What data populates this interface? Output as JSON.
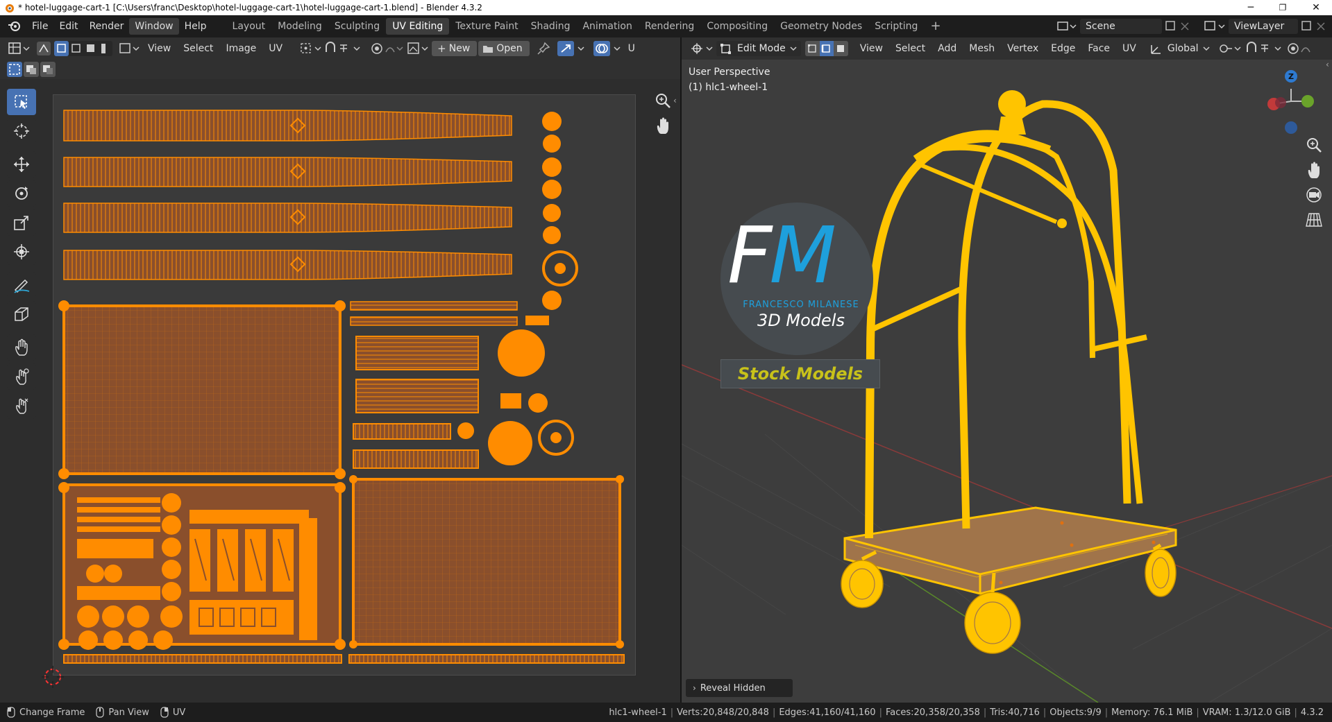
{
  "window": {
    "title": "* hotel-luggage-cart-1 [C:\\Users\\franc\\Desktop\\hotel-luggage-cart-1\\hotel-luggage-cart-1.blend] - Blender 4.3.2",
    "minimize": "─",
    "maximize": "❐",
    "close": "✕"
  },
  "menubar": {
    "items": [
      "File",
      "Edit",
      "Render",
      "Window",
      "Help"
    ],
    "active": "Window"
  },
  "workspaces": {
    "tabs": [
      "Layout",
      "Modeling",
      "Sculpting",
      "UV Editing",
      "Texture Paint",
      "Shading",
      "Animation",
      "Rendering",
      "Compositing",
      "Geometry Nodes",
      "Scripting"
    ],
    "active": "UV Editing",
    "add_label": "+"
  },
  "scene": {
    "label": "Scene"
  },
  "viewlayer": {
    "label": "ViewLayer"
  },
  "uv_editor": {
    "menus": [
      "View",
      "Select",
      "Image",
      "UV"
    ],
    "new_label": "New",
    "open_label": "Open",
    "cut_label": "U"
  },
  "viewport": {
    "mode_label": "Edit Mode",
    "menus": [
      "View",
      "Select",
      "Add",
      "Mesh",
      "Vertex",
      "Edge",
      "Face",
      "UV"
    ],
    "transform_orientation": "Global",
    "perspective_label": "User Perspective",
    "object_label": "(1) hlc1-wheel-1",
    "reveal_hidden_label": "Reveal Hidden",
    "gizmo_z": "Z"
  },
  "watermark": {
    "logo_f": "F",
    "logo_m": "M",
    "brand": "FRANCESCO MILANESE",
    "subtitle": "3D Models",
    "badge": "Stock Models"
  },
  "statusbar": {
    "hints": [
      "Change Frame",
      "Pan View",
      "UV"
    ],
    "object": "hlc1-wheel-1",
    "verts": "Verts:20,848/20,848",
    "edges": "Edges:41,160/41,160",
    "faces": "Faces:20,358/20,358",
    "tris": "Tris:40,716",
    "objects": "Objects:9/9",
    "memory": "Memory: 76.1 MiB",
    "vram": "VRAM: 1.3/12.0 GiB",
    "version": "4.3.2"
  },
  "colors": {
    "uv_orange": "#ff8c00",
    "uv_fill": "#8a4f2c",
    "wire_yellow": "#ffc400",
    "accent_blue": "#4772b3",
    "fm_blue": "#1ea0dc",
    "badge_yellow": "#c8c21a"
  }
}
